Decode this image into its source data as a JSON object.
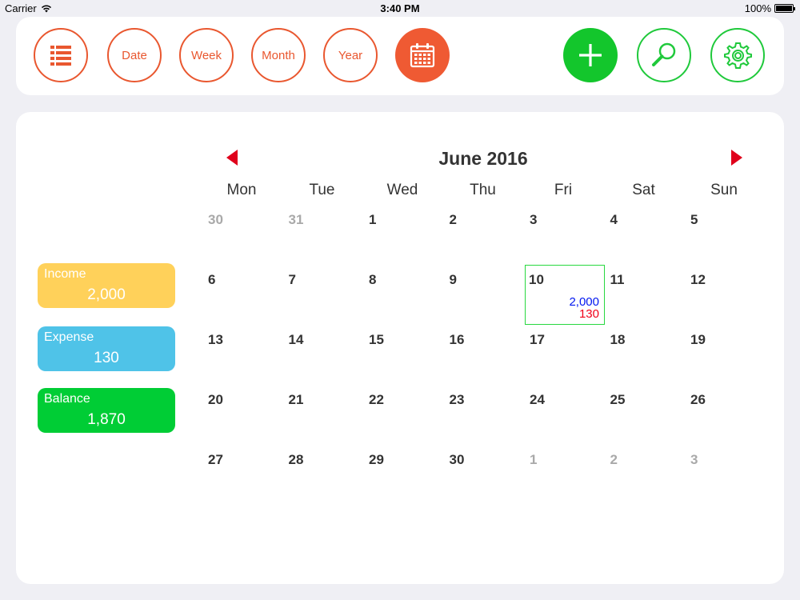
{
  "status": {
    "carrier": "Carrier",
    "time": "3:40 PM",
    "battery": "100%"
  },
  "toolbar": {
    "date": "Date",
    "week": "Week",
    "month": "Month",
    "year": "Year"
  },
  "colors": {
    "accent_orange": "#ef5a33",
    "accent_green": "#13c62c",
    "income": "#ffd15a",
    "expense": "#4fc3e8",
    "balance": "#00cd35",
    "income_text": "#0016f0",
    "expense_text": "#f00018"
  },
  "icons": [
    "list-icon",
    "calendar-icon",
    "plus-icon",
    "search-icon",
    "gear-icon",
    "prev-arrow-icon",
    "next-arrow-icon",
    "wifi-icon",
    "battery-icon"
  ],
  "calendar": {
    "title": "June 2016",
    "weekdays": [
      "Mon",
      "Tue",
      "Wed",
      "Thu",
      "Fri",
      "Sat",
      "Sun"
    ],
    "weeks": [
      [
        {
          "d": "30",
          "other": true
        },
        {
          "d": "31",
          "other": true
        },
        {
          "d": "1"
        },
        {
          "d": "2"
        },
        {
          "d": "3"
        },
        {
          "d": "4"
        },
        {
          "d": "5"
        }
      ],
      [
        {
          "d": "6"
        },
        {
          "d": "7"
        },
        {
          "d": "8"
        },
        {
          "d": "9"
        },
        {
          "d": "10",
          "selected": true,
          "income": "2,000",
          "expense": "130"
        },
        {
          "d": "11"
        },
        {
          "d": "12"
        }
      ],
      [
        {
          "d": "13"
        },
        {
          "d": "14"
        },
        {
          "d": "15"
        },
        {
          "d": "16"
        },
        {
          "d": "17"
        },
        {
          "d": "18"
        },
        {
          "d": "19"
        }
      ],
      [
        {
          "d": "20"
        },
        {
          "d": "21"
        },
        {
          "d": "22"
        },
        {
          "d": "23"
        },
        {
          "d": "24"
        },
        {
          "d": "25"
        },
        {
          "d": "26"
        }
      ],
      [
        {
          "d": "27"
        },
        {
          "d": "28"
        },
        {
          "d": "29"
        },
        {
          "d": "30"
        },
        {
          "d": "1",
          "other": true
        },
        {
          "d": "2",
          "other": true
        },
        {
          "d": "3",
          "other": true
        }
      ]
    ]
  },
  "summary": {
    "income": {
      "label": "Income",
      "value": "2,000"
    },
    "expense": {
      "label": "Expense",
      "value": "130"
    },
    "balance": {
      "label": "Balance",
      "value": "1,870"
    }
  }
}
